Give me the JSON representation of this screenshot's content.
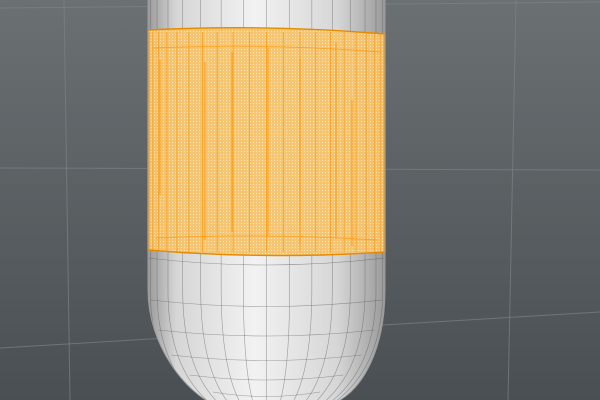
{
  "viewport": {
    "background_top": "#6b7073",
    "background_bottom": "#4a4f53",
    "grid_color": "#7d8286"
  },
  "mesh": {
    "surface_light": "#f2f2f2",
    "surface_mid": "#d6d6d6",
    "surface_dark": "#9a9a9a",
    "wire_color": "#5a5a5a",
    "selection_fill": "#f6c36a",
    "selection_wire": "#ff9a12",
    "selection_edge": "#e58a00"
  }
}
